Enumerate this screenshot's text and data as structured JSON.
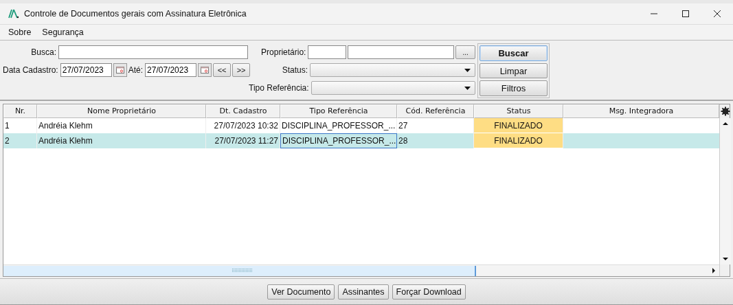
{
  "window": {
    "title": "Controle de Documentos gerais com Assinatura Eletrônica"
  },
  "menu": [
    "Sobre",
    "Segurança"
  ],
  "filters": {
    "busca_label": "Busca:",
    "data_label": "Data Cadastro:",
    "data_de": "27/07/2023",
    "ate_label": "Até:",
    "data_ate": "27/07/2023",
    "prev": "<<",
    "next": ">>",
    "proprietario_label": "Proprietário:",
    "proprietario_button": "...",
    "status_label": "Status:",
    "tipo_label": "Tipo Referência:"
  },
  "actions": [
    {
      "label": "Buscar",
      "default": true
    },
    {
      "label": "Limpar",
      "default": false
    },
    {
      "label": "Filtros",
      "default": false
    }
  ],
  "table": {
    "columns": [
      "Nr.",
      "Nome Proprietário",
      "Dt. Cadastro",
      "Tipo Referência",
      "Cód. Referência",
      "Status",
      "Msg. Integradora"
    ],
    "rows": [
      {
        "nr": "1",
        "nome": "Andréia Klehm",
        "dt": "27/07/2023 10:32",
        "tipo": "DISCIPLINA_PROFESSOR_...",
        "cod": "27",
        "status": "FINALIZADO",
        "selected": false
      },
      {
        "nr": "2",
        "nome": "Andréia Klehm",
        "dt": "27/07/2023 11:27",
        "tipo": "DISCIPLINA_PROFESSOR_...",
        "cod": "28",
        "status": "FINALIZADO",
        "selected": true
      }
    ]
  },
  "buttons": [
    "Ver Documento",
    "Assinantes",
    "Forçar Download"
  ]
}
